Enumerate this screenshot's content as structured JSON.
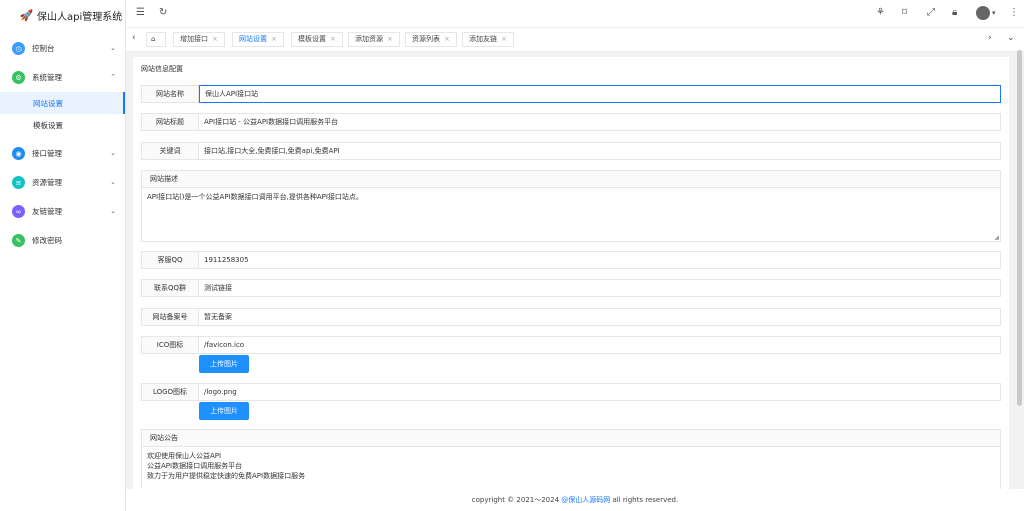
{
  "app": {
    "title": "保山人api管理系统"
  },
  "sidebar": {
    "items": [
      {
        "label": "控制台",
        "icon": "dashboard-icon",
        "color": "#3b9cff"
      },
      {
        "label": "系统管理",
        "icon": "settings-icon",
        "color": "#36c25e"
      },
      {
        "label": "接口管理",
        "icon": "api-icon",
        "color": "#1e8cf0"
      },
      {
        "label": "资源管理",
        "icon": "resource-icon",
        "color": "#13c2c2"
      },
      {
        "label": "友链管理",
        "icon": "link-icon",
        "color": "#7b61ff"
      },
      {
        "label": "修改密码",
        "icon": "password-icon",
        "color": "#36c25e"
      }
    ],
    "subitems": [
      {
        "label": "网站设置",
        "active": true
      },
      {
        "label": "模板设置",
        "active": false
      }
    ]
  },
  "tabs": [
    {
      "label": "增加接口"
    },
    {
      "label": "网站设置",
      "active": true
    },
    {
      "label": "模板设置"
    },
    {
      "label": "添加资源"
    },
    {
      "label": "资源列表"
    },
    {
      "label": "添加友链"
    }
  ],
  "form": {
    "section_title": "网站信息配置",
    "site_name": {
      "label": "网站名称",
      "value": "保山人API接口站"
    },
    "site_title": {
      "label": "网站标题",
      "value": "API接口站 - 公益API数据接口调用服务平台"
    },
    "keywords": {
      "label": "关键词",
      "value": "接口站,接口大全,免费接口,免费api,免费API"
    },
    "description": {
      "label": "网站描述",
      "value": "API接口站()是一个公益API数据接口调用平台,提供各种API接口站点。"
    },
    "qq": {
      "label": "客服QQ",
      "value": "1911258305"
    },
    "qq_group": {
      "label": "联系QQ群",
      "value": "测试链接"
    },
    "icp": {
      "label": "网站备案号",
      "value": "暂无备案"
    },
    "ico": {
      "label": "ICO图标",
      "value": "/favicon.ico",
      "button": "上传图片"
    },
    "logo": {
      "label": "LOGO图标",
      "value": "/logo.png",
      "button": "上传图片"
    },
    "notice": {
      "label": "网站公告",
      "lines": [
        "欢迎使用保山人公益API",
        "公益API数据接口调用服务平台",
        "致力于为用户提供稳定快速的免费API数据接口服务"
      ]
    }
  },
  "footer": {
    "prefix": "copyright © 2021～2024 ",
    "brand": "@保山人源码网",
    "suffix": " all rights reserved."
  }
}
